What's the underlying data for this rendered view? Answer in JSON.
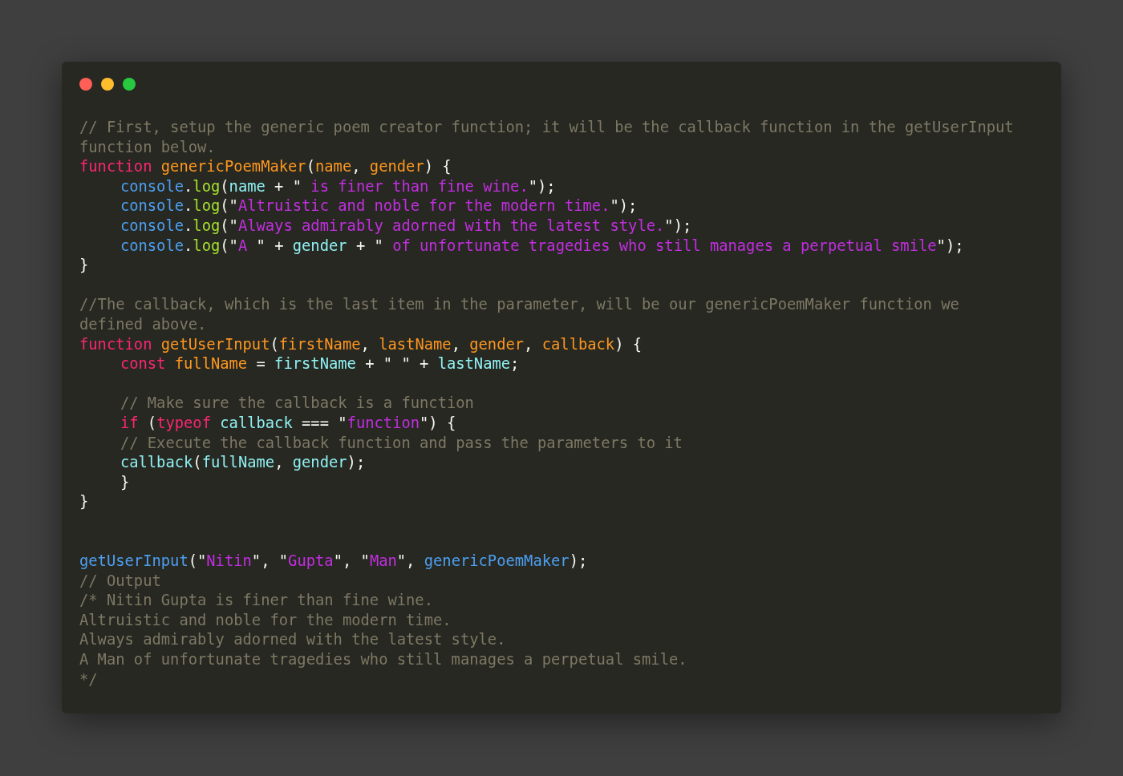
{
  "window": {
    "controls": [
      {
        "kind": "close"
      },
      {
        "kind": "minimize"
      },
      {
        "kind": "zoom"
      }
    ]
  },
  "code": [
    {
      "kind": "code",
      "tokens": [
        {
          "kind": "comment",
          "text": "// First, setup the generic poem creator function; it will be the callback function in the getUserInput"
        }
      ]
    },
    {
      "kind": "code",
      "tokens": [
        {
          "kind": "comment",
          "text": "function below."
        }
      ]
    },
    {
      "kind": "code",
      "tokens": [
        {
          "kind": "keyword",
          "text": "function "
        },
        {
          "kind": "param",
          "text": "genericPoemMaker"
        },
        {
          "kind": "plain",
          "text": "("
        },
        {
          "kind": "param",
          "text": "name"
        },
        {
          "kind": "plain",
          "text": ", "
        },
        {
          "kind": "param",
          "text": "gender"
        },
        {
          "kind": "plain",
          "text": ") {"
        }
      ]
    },
    {
      "kind": "code",
      "indent": true,
      "tokens": [
        {
          "kind": "object",
          "text": "console"
        },
        {
          "kind": "plain",
          "text": "."
        },
        {
          "kind": "method",
          "text": "log"
        },
        {
          "kind": "plain",
          "text": "("
        },
        {
          "kind": "variable",
          "text": "name"
        },
        {
          "kind": "plain",
          "text": " + \""
        },
        {
          "kind": "string",
          "text": " is finer than fine wine."
        },
        {
          "kind": "plain",
          "text": "\");"
        }
      ]
    },
    {
      "kind": "code",
      "indent": true,
      "tokens": [
        {
          "kind": "member",
          "object": "console",
          "sep": ".",
          "method": "log"
        },
        {
          "kind": "plain",
          "text": "(\""
        },
        {
          "kind": "string",
          "text": "Altruistic and noble for the modern time."
        },
        {
          "kind": "plain",
          "text": "\");"
        }
      ]
    },
    {
      "kind": "code",
      "indent": true,
      "tokens": [
        {
          "kind": "member",
          "object": "console",
          "sep": ".",
          "method": "log"
        },
        {
          "kind": "plain",
          "text": "(\""
        },
        {
          "kind": "string",
          "text": "Always admirably adorned with the latest style."
        },
        {
          "kind": "plain",
          "text": "\");"
        }
      ]
    },
    {
      "kind": "code",
      "indent": true,
      "tokens": [
        {
          "kind": "object",
          "text": "console"
        },
        {
          "kind": "plain",
          "text": "."
        },
        {
          "kind": "method",
          "text": "log"
        },
        {
          "kind": "plain",
          "text": "(\""
        },
        {
          "kind": "string",
          "text": "A "
        },
        {
          "kind": "plain",
          "text": "\" + "
        },
        {
          "kind": "variable",
          "text": "gender"
        },
        {
          "kind": "plain",
          "text": " + \""
        },
        {
          "kind": "string",
          "text": " of unfortunate tragedies who still manages a perpetual smile"
        },
        {
          "kind": "plain",
          "text": "\");"
        }
      ]
    },
    {
      "kind": "code",
      "tokens": [
        {
          "kind": "plain",
          "text": "}"
        }
      ]
    },
    {
      "kind": "blank"
    },
    {
      "kind": "code",
      "tokens": [
        {
          "kind": "comment",
          "text": "//The callback, which is the last item in the parameter, will be our genericPoemMaker function we"
        }
      ]
    },
    {
      "kind": "code",
      "tokens": [
        {
          "kind": "comment",
          "text": "defined above."
        }
      ]
    },
    {
      "kind": "code",
      "tokens": [
        {
          "kind": "keyword",
          "text": "function "
        },
        {
          "kind": "param",
          "text": "getUserInput"
        },
        {
          "kind": "plain",
          "text": "("
        },
        {
          "kind": "param",
          "text": "firstName"
        },
        {
          "kind": "plain",
          "text": ", "
        },
        {
          "kind": "param",
          "text": "lastName"
        },
        {
          "kind": "plain",
          "text": ", "
        },
        {
          "kind": "param",
          "text": "gender"
        },
        {
          "kind": "plain",
          "text": ", "
        },
        {
          "kind": "param",
          "text": "callback"
        },
        {
          "kind": "plain",
          "text": ") {"
        }
      ]
    },
    {
      "kind": "code",
      "indent": true,
      "tokens": [
        {
          "kind": "keyword",
          "text": "const "
        },
        {
          "kind": "param",
          "text": "fullName"
        },
        {
          "kind": "plain",
          "text": " = "
        },
        {
          "kind": "variable",
          "text": "firstName"
        },
        {
          "kind": "plain",
          "text": " + \" \" + "
        },
        {
          "kind": "variable",
          "text": "lastName"
        },
        {
          "kind": "plain",
          "text": ";"
        }
      ]
    },
    {
      "kind": "blank"
    },
    {
      "kind": "code",
      "indent": true,
      "tokens": [
        {
          "kind": "comment",
          "text": "// Make sure the callback is a function"
        }
      ]
    },
    {
      "kind": "code",
      "indent": true,
      "tokens": [
        {
          "kind": "keyword",
          "text": "if"
        },
        {
          "kind": "plain",
          "text": " ("
        },
        {
          "kind": "keyword",
          "text": "typeof "
        },
        {
          "kind": "variable",
          "text": "callback"
        },
        {
          "kind": "plain",
          "text": " === \""
        },
        {
          "kind": "string",
          "text": "function"
        },
        {
          "kind": "plain",
          "text": "\") {"
        }
      ]
    },
    {
      "kind": "code",
      "indent": true,
      "tokens": [
        {
          "kind": "comment",
          "text": "// Execute the callback function and pass the parameters to it"
        }
      ]
    },
    {
      "kind": "code",
      "indent": true,
      "tokens": [
        {
          "kind": "variable",
          "text": "callback"
        },
        {
          "kind": "plain",
          "text": "("
        },
        {
          "kind": "variable",
          "text": "fullName"
        },
        {
          "kind": "plain",
          "text": ", "
        },
        {
          "kind": "variable",
          "text": "gender"
        },
        {
          "kind": "plain",
          "text": ");"
        }
      ]
    },
    {
      "kind": "code",
      "indent": true,
      "tokens": [
        {
          "kind": "plain",
          "text": "}"
        }
      ]
    },
    {
      "kind": "code",
      "tokens": [
        {
          "kind": "plain",
          "text": "}"
        }
      ]
    },
    {
      "kind": "blank"
    },
    {
      "kind": "blank"
    },
    {
      "kind": "code",
      "tokens": [
        {
          "kind": "object",
          "text": "getUserInput"
        },
        {
          "kind": "plain",
          "text": "(\""
        },
        {
          "kind": "string",
          "text": "Nitin"
        },
        {
          "kind": "plain",
          "text": "\", \""
        },
        {
          "kind": "string",
          "text": "Gupta"
        },
        {
          "kind": "plain",
          "text": "\", \""
        },
        {
          "kind": "string",
          "text": "Man"
        },
        {
          "kind": "plain",
          "text": "\", "
        },
        {
          "kind": "object",
          "text": "genericPoemMaker"
        },
        {
          "kind": "plain",
          "text": ");"
        }
      ]
    },
    {
      "kind": "code",
      "tokens": [
        {
          "kind": "comment",
          "text": "// Output"
        }
      ]
    },
    {
      "kind": "code",
      "tokens": [
        {
          "kind": "comment",
          "text": "/* Nitin Gupta is finer than fine wine."
        }
      ]
    },
    {
      "kind": "code",
      "tokens": [
        {
          "kind": "comment",
          "text": "Altruistic and noble for the modern time."
        }
      ]
    },
    {
      "kind": "code",
      "tokens": [
        {
          "kind": "comment",
          "text": "Always admirably adorned with the latest style."
        }
      ]
    },
    {
      "kind": "code",
      "tokens": [
        {
          "kind": "comment",
          "text": "A Man of unfortunate tragedies who still manages a perpetual smile."
        }
      ]
    },
    {
      "kind": "code",
      "tokens": [
        {
          "kind": "comment",
          "text": "*/"
        }
      ]
    }
  ]
}
